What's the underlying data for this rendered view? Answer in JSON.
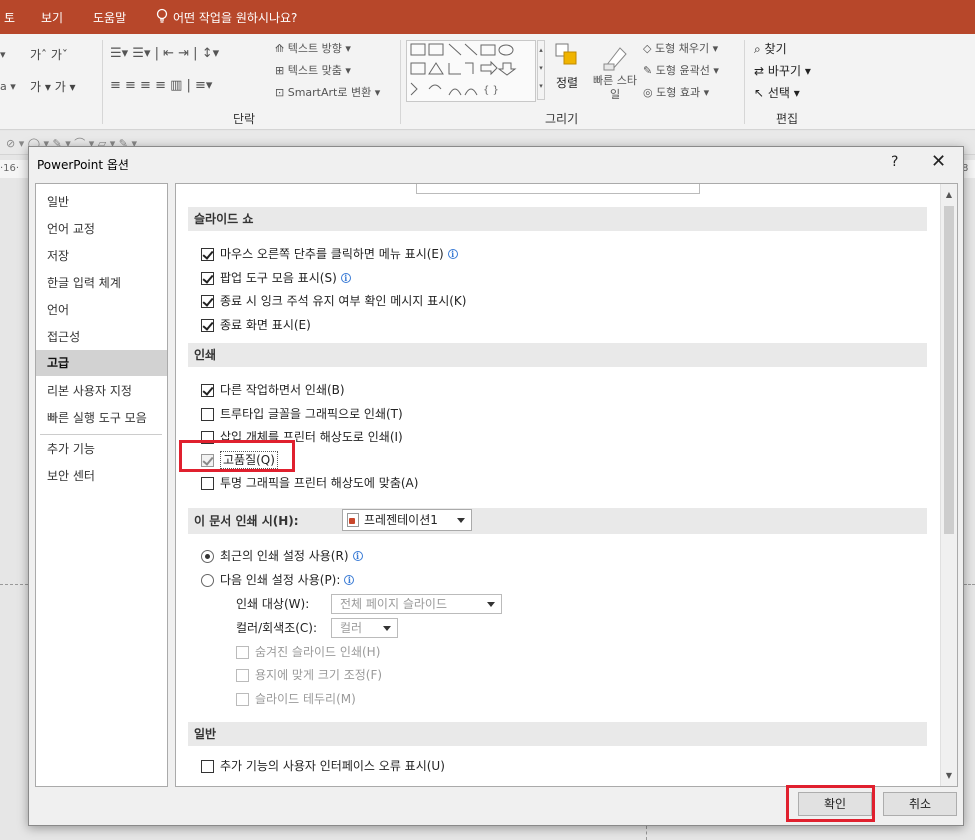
{
  "app": {
    "tabs": [
      "토",
      "보기",
      "도움말"
    ],
    "tell_me": "어떤 작업을 원하시나요?",
    "ribbon": {
      "text_direction": "텍스트 방향",
      "text_align": "텍스트 맞춤",
      "smartart": "SmartArt로 변환",
      "arrange": "정렬",
      "quick_styles": "빠른 스타일",
      "shape_fill": "도형 채우기",
      "shape_outline": "도형 윤곽선",
      "shape_effects": "도형 효과",
      "find": "찾기",
      "replace": "바꾸기",
      "select": "선택",
      "group_paragraph": "단락",
      "group_drawing": "그리기",
      "group_editing": "편집"
    },
    "ruler_left": "·16·",
    "ruler_right": "8"
  },
  "dialog": {
    "title": "PowerPoint 옵션",
    "help": "?",
    "close": "✕",
    "nav": [
      "일반",
      "언어 교정",
      "저장",
      "한글 입력 체계",
      "언어",
      "접근성",
      "고급",
      "리본 사용자 지정",
      "빠른 실행 도구 모음",
      "추가 기능",
      "보안 센터"
    ],
    "selected_nav": "고급",
    "slideshow": {
      "header": "슬라이드 쇼",
      "items": [
        {
          "label": "마우스 오른쪽 단추를 클릭하면 메뉴 표시(E)",
          "checked": true,
          "info": true
        },
        {
          "label": "팝업 도구 모음 표시(S)",
          "checked": true,
          "info": true
        },
        {
          "label": "종료 시 잉크 주석 유지 여부 확인 메시지 표시(K)",
          "checked": true,
          "info": false
        },
        {
          "label": "종료 화면 표시(E)",
          "checked": true,
          "info": false
        }
      ]
    },
    "print": {
      "header": "인쇄",
      "items": [
        {
          "label": "다른 작업하면서 인쇄(B)",
          "checked": true
        },
        {
          "label": "트루타입 글꼴을 그래픽으로 인쇄(T)",
          "checked": false
        },
        {
          "label": "삽입 개체를 프린터 해상도로 인쇄(I)",
          "checked": false
        },
        {
          "label": "고품질(Q)",
          "checked": true
        },
        {
          "label": "투명 그래픽을 프린터 해상도에 맞춤(A)",
          "checked": false
        }
      ]
    },
    "print_doc": {
      "label": "이 문서 인쇄 시(H):",
      "document": "프레젠테이션1",
      "radio_recent": "최근의 인쇄 설정 사용(R)",
      "radio_following": "다음 인쇄 설정 사용(P):",
      "target_label": "인쇄 대상(W):",
      "target_value": "전체 페이지 슬라이드",
      "color_label": "컬러/회색조(C):",
      "color_value": "컬러",
      "hidden_slides": "숨겨진 슬라이드 인쇄(H)",
      "fit_paper": "용지에 맞게 크기 조정(F)",
      "frame_slides": "슬라이드 테두리(M)"
    },
    "general": {
      "header": "일반",
      "addin_errors": "추가 기능의 사용자 인터페이스 오류 표시(U)"
    },
    "ok": "확인",
    "cancel": "취소"
  },
  "colors": {
    "title_bar": "#b7472a",
    "highlight": "#e0202e"
  }
}
